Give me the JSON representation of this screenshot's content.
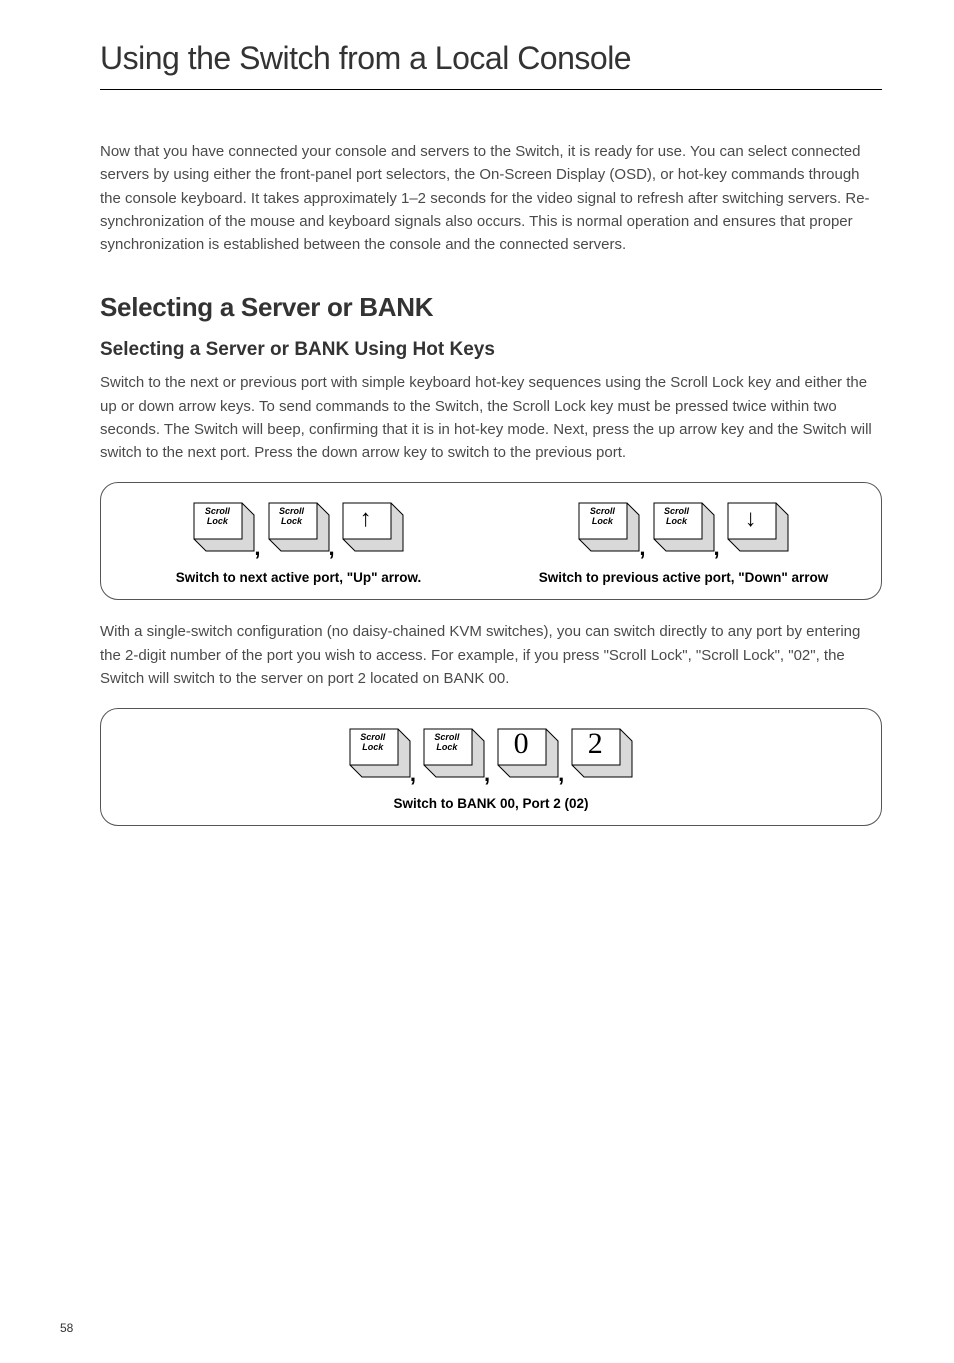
{
  "page_title": "Using the Switch from a Local Console",
  "intro": "Now that you have connected your console and servers to the Switch, it is ready for use. You can select connected servers by using either the front-panel port selectors, the On-Screen Display (OSD), or hot-key commands through the console keyboard. It takes approximately 1–2 seconds for the video signal to refresh after switching servers. Re-synchronization of the mouse and keyboard signals also occurs. This is normal operation and ensures that proper synchronization is established between the console and the connected servers.",
  "h2": "Selecting a Server or BANK",
  "h3": "Selecting a Server or BANK Using Hot Keys",
  "para1": "Switch to the next or previous port with simple keyboard hot-key sequences using the Scroll Lock key and either the up or down arrow keys. To send commands to the Switch, the Scroll Lock key must be pressed twice within two seconds. The Switch will beep, confirming that it is in hot-key mode. Next, press the up arrow key and the Switch will switch to the next port. Press the down arrow key to switch to the previous port.",
  "diagram1": {
    "left": {
      "keys": [
        "Scroll Lock",
        "Scroll Lock"
      ],
      "arrow": "↑",
      "caption": "Switch to next active port, \"Up\" arrow."
    },
    "right": {
      "keys": [
        "Scroll Lock",
        "Scroll Lock"
      ],
      "arrow": "↓",
      "caption": "Switch to previous active port, \"Down\" arrow"
    }
  },
  "para2": "With a single-switch configuration (no daisy-chained KVM switches), you can switch directly to any port by entering the 2-digit number of the port you wish to access. For example, if you press \"Scroll Lock\", \"Scroll Lock\", \"02\", the Switch will switch to the server on port 2 located on BANK 00.",
  "diagram2": {
    "keys": [
      "Scroll Lock",
      "Scroll Lock"
    ],
    "digits": [
      "0",
      "2"
    ],
    "caption": "Switch to BANK 00, Port 2 (02)"
  },
  "page_number": "58"
}
